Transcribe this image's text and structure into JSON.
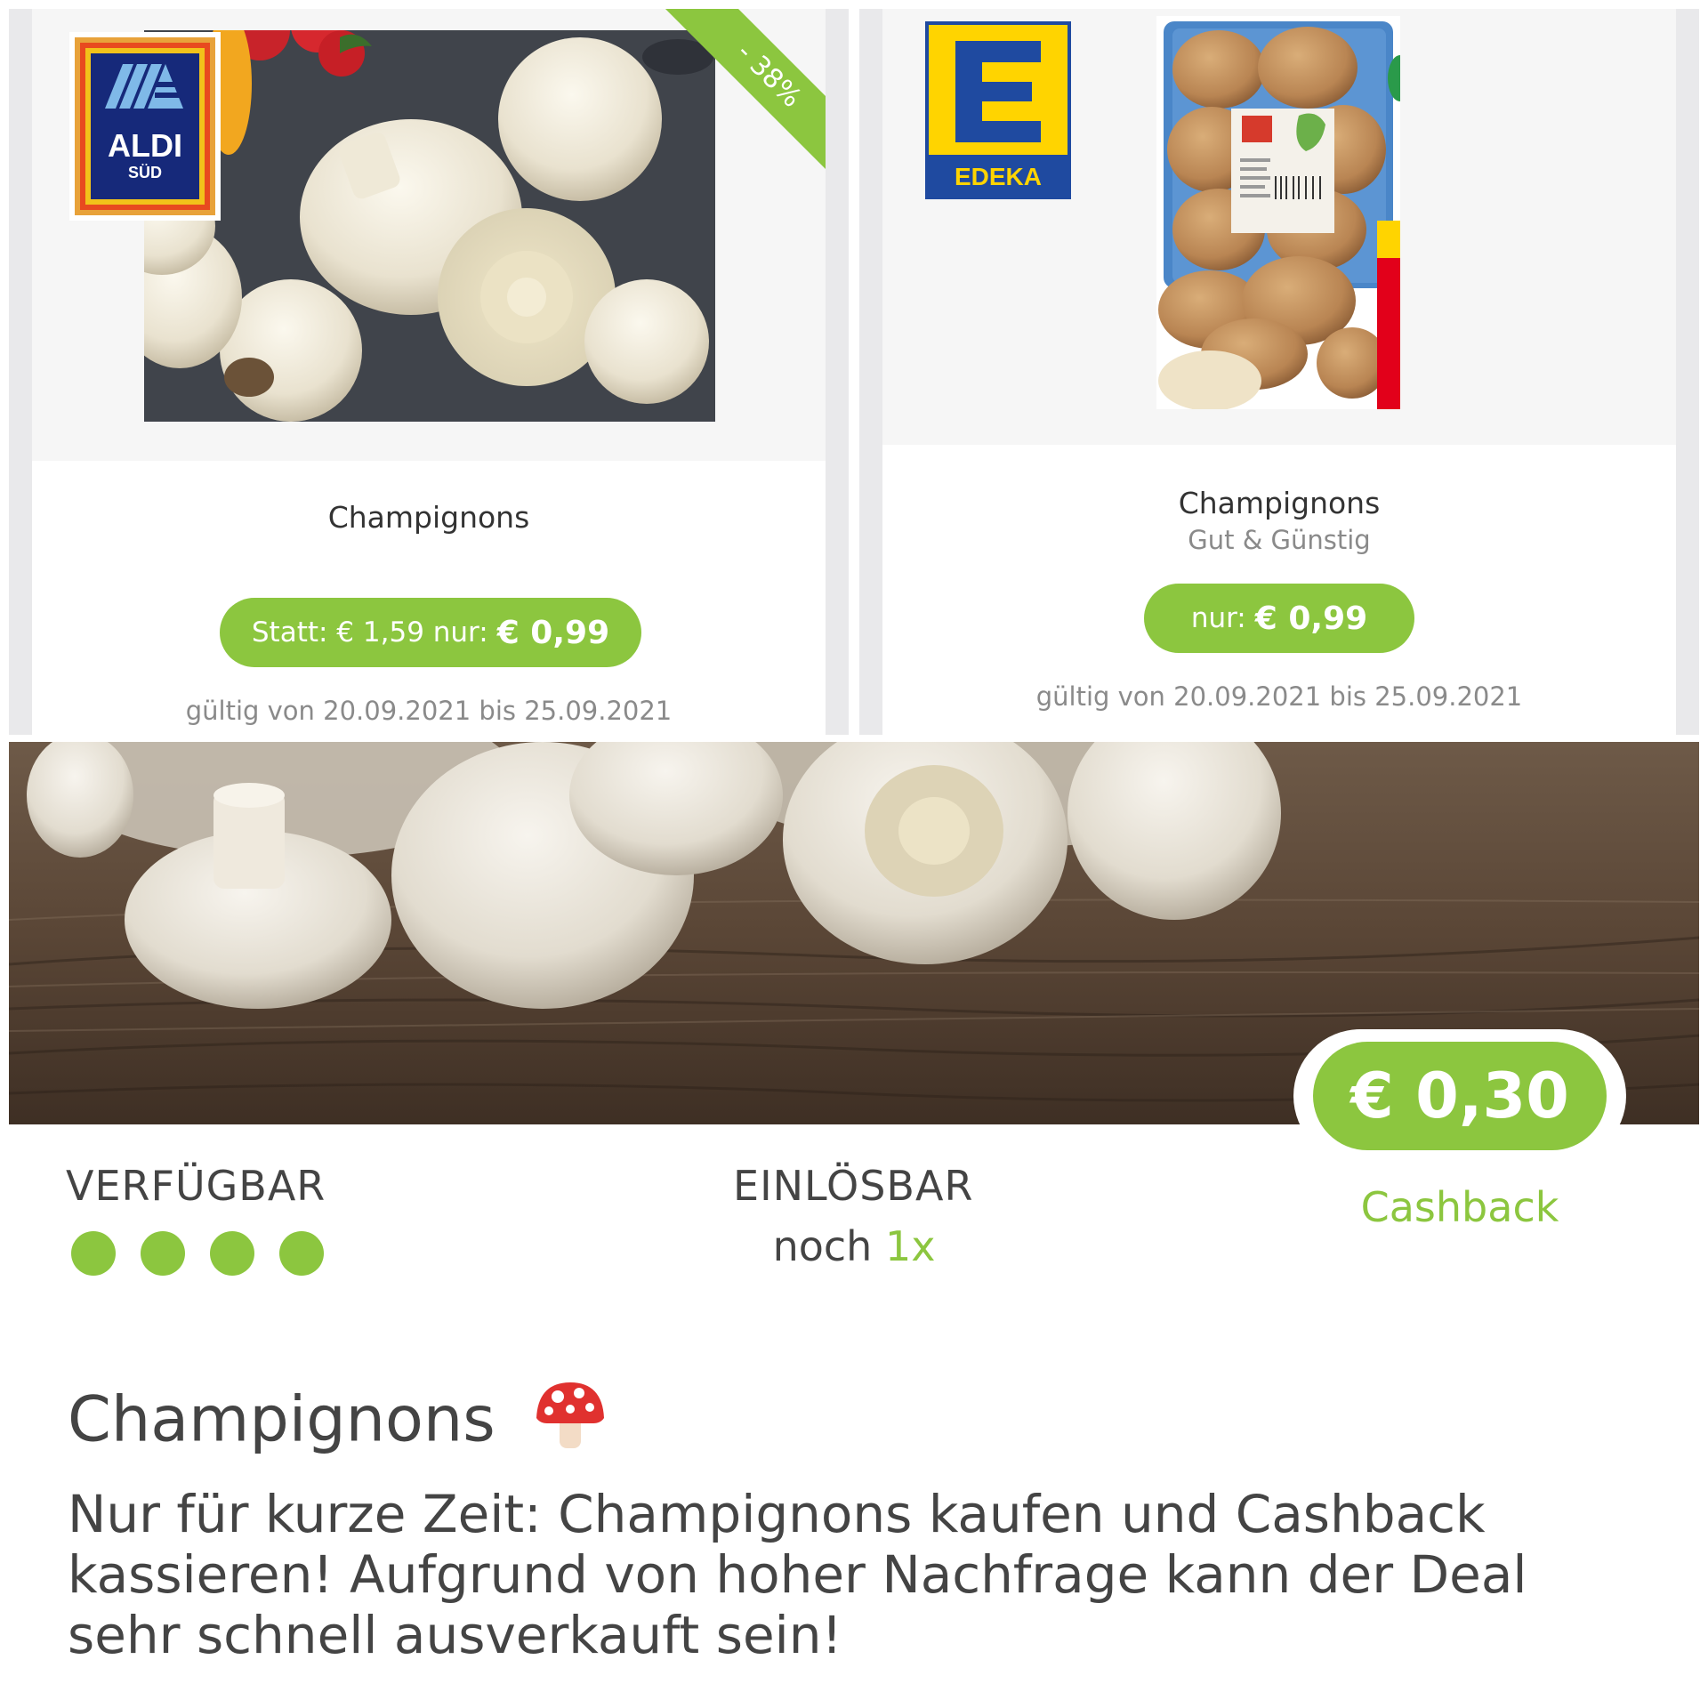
{
  "offers": [
    {
      "store": "ALDI SÜD",
      "logo_text": "ALDI",
      "logo_sub": "SÜD",
      "discount_badge": "- 38%",
      "title": "Champignons",
      "price_label": "Statt: € 1,59 nur:",
      "price_value": "€ 0,99",
      "validity": "gültig von 20.09.2021 bis 25.09.2021"
    },
    {
      "store": "EDEKA",
      "logo_text": "EDEKA",
      "title": "Champignons",
      "subtitle": "Gut & Günstig",
      "price_label": "nur:",
      "price_value": "€ 0,99",
      "validity": "gültig von 20.09.2021 bis 25.09.2021"
    }
  ],
  "cashback": {
    "amount": "€ 0,30",
    "label": "Cashback"
  },
  "availability": {
    "label": "VERFÜGBAR",
    "dots": 4
  },
  "redeemable": {
    "label": "EINLÖSBAR",
    "prefix": "noch",
    "count": "1x"
  },
  "product": {
    "title": "Champignons",
    "emoji": "🍄",
    "description": "Nur für kurze Zeit: Champignons kaufen und Cashback kassieren! Aufgrund von hoher Nachfrage kann der Deal sehr schnell ausverkauft sein!"
  },
  "colors": {
    "accent": "#8cc63f",
    "aldi_blue": "#1a2a6c",
    "edeka_yellow": "#ffd400",
    "edeka_blue": "#1f4aa0"
  }
}
